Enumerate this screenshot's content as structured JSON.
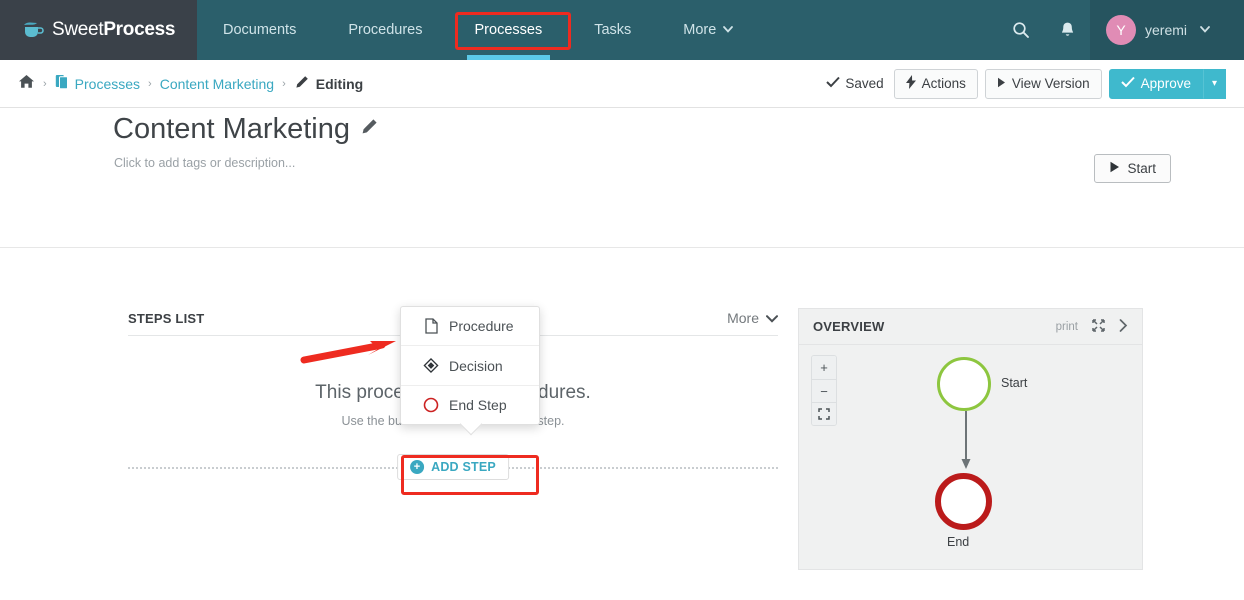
{
  "brand": {
    "name_light": "Sweet",
    "name_bold": "Process",
    "logo_icon": "coffee-cup-icon"
  },
  "topnav": {
    "items": [
      {
        "label": "Documents",
        "active": false
      },
      {
        "label": "Procedures",
        "active": false
      },
      {
        "label": "Processes",
        "active": true
      },
      {
        "label": "Tasks",
        "active": false
      },
      {
        "label": "More",
        "active": false,
        "caret": "⌄"
      }
    ],
    "search_icon": "search-icon",
    "notifications_icon": "bell-icon",
    "user": {
      "initial": "Y",
      "name": "yeremi",
      "caret": "⌄",
      "avatar_color": "#e08cb5"
    }
  },
  "breadcrumb": {
    "home_icon": "home-icon",
    "items": [
      {
        "label": "Processes",
        "icon": "documents-icon",
        "link": true
      },
      {
        "label": "Content Marketing",
        "link": true
      },
      {
        "label": "Editing",
        "icon": "pencil-icon",
        "link": false
      }
    ],
    "separator": "›"
  },
  "doc_actions": {
    "saved_label": "Saved",
    "saved_icon": "check-icon",
    "actions_label": "Actions",
    "actions_icon": "bolt-icon",
    "view_version_label": "View Version",
    "view_version_icon": "play-icon",
    "approve_label": "Approve",
    "approve_icon": "check-icon",
    "approve_caret": "▾"
  },
  "title_block": {
    "title": "Content Marketing",
    "edit_icon": "pencil-icon",
    "subtitle_placeholder": "Click to add tags or description...",
    "start_label": "Start",
    "start_icon": "play-icon"
  },
  "steps_panel": {
    "heading": "STEPS LIST",
    "more_label": "More",
    "more_caret": "⌄",
    "empty_primary": "This process has no procedures.",
    "empty_secondary": "Use the button below to add a new step.",
    "add_step_label": "ADD STEP",
    "add_step_icon": "plus-circle-icon"
  },
  "add_step_menu": {
    "items": [
      {
        "label": "Procedure",
        "icon": "file-icon"
      },
      {
        "label": "Decision",
        "icon": "diamond-icon"
      },
      {
        "label": "End Step",
        "icon": "circle-red-icon"
      }
    ]
  },
  "overview": {
    "heading": "OVERVIEW",
    "print_label": "print",
    "fullscreen_icon": "expand-icon",
    "collapse_icon": "chevron-right-icon",
    "zoom_in": "+",
    "zoom_out": "−",
    "zoom_fit_icon": "fit-screen-icon",
    "nodes": [
      {
        "label": "Start",
        "type": "start",
        "color": "#8dc63f"
      },
      {
        "label": "End",
        "type": "end",
        "color": "#bb1b1b"
      }
    ]
  },
  "annotations": {
    "highlight_color": "#ee2b20",
    "arrow_icon": "red-arrow-icon",
    "boxes": [
      "processes-tab",
      "add-step-button"
    ]
  },
  "colors": {
    "nav_teal": "#2b5f6b",
    "nav_dark": "#3a4149",
    "accent_blue": "#3aa8c1",
    "active_underline": "#5bc8e8",
    "approve": "#3fb9cd"
  }
}
